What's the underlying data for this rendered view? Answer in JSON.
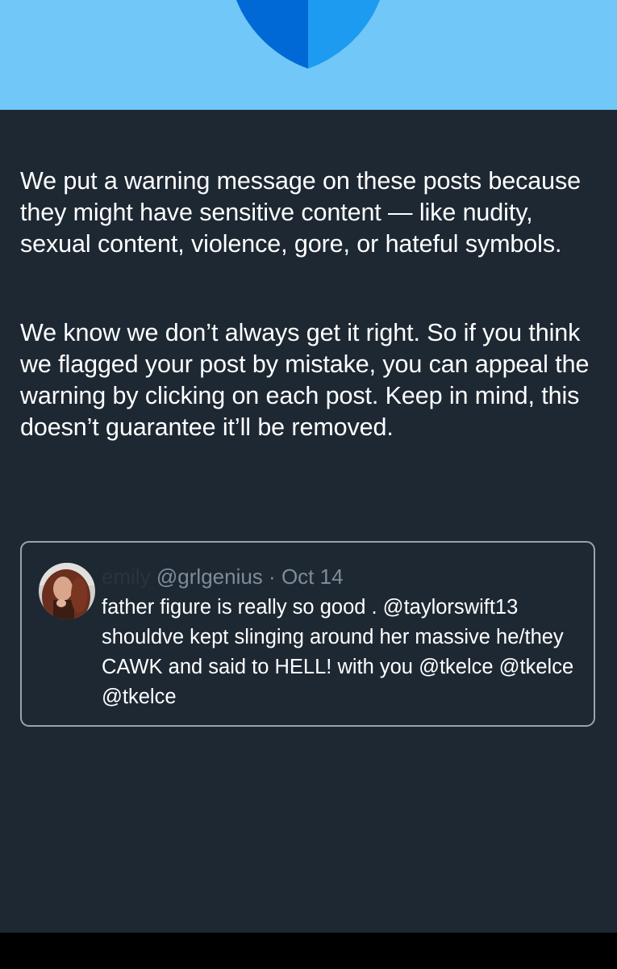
{
  "header": {
    "icon": "shield-icon",
    "colors": {
      "banner_bg": "#71c7f7",
      "shield_dark": "#0069d5",
      "shield_light": "#1d9bf0"
    }
  },
  "notice": {
    "paragraph_1": "We put a warning message on these posts because they might have sensitive content — like nudity, sexual content, violence, gore, or hateful symbols.",
    "paragraph_2": "We know we don’t always get it right. So if you think we flagged your post by mistake, you can appeal the warning by clicking on each post. Keep in mind, this doesn’t guarantee it’ll be removed."
  },
  "quoted_post": {
    "display_name": "emily",
    "handle": "@grlgenius",
    "separator": "·",
    "date": "Oct 14",
    "text": "father figure is really so good . @taylorswift13 shouldve kept slinging around her massive he/they CAWK and said to HELL! with you @tkelce @tkelce @tkelce"
  },
  "theme": {
    "panel_bg": "#1d2833",
    "card_border": "#9aa3ab",
    "muted_text": "#7f8c99"
  }
}
